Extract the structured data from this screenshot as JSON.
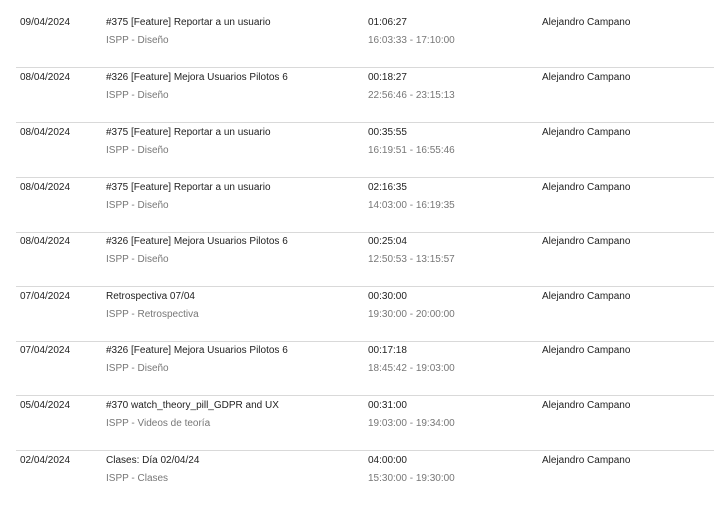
{
  "entries": [
    {
      "date": "09/04/2024",
      "task": "#375 [Feature] Reportar a un usuario",
      "project": "ISPP - Diseño",
      "duration": "01:06:27",
      "range": "16:03:33 - 17:10:00",
      "user": "Alejandro Campano"
    },
    {
      "date": "08/04/2024",
      "task": "#326 [Feature] Mejora Usuarios Pilotos 6",
      "project": "ISPP - Diseño",
      "duration": "00:18:27",
      "range": "22:56:46 - 23:15:13",
      "user": "Alejandro Campano"
    },
    {
      "date": "08/04/2024",
      "task": "#375 [Feature] Reportar a un usuario",
      "project": "ISPP - Diseño",
      "duration": "00:35:55",
      "range": "16:19:51 - 16:55:46",
      "user": "Alejandro Campano"
    },
    {
      "date": "08/04/2024",
      "task": "#375 [Feature] Reportar a un usuario",
      "project": "ISPP - Diseño",
      "duration": "02:16:35",
      "range": "14:03:00 - 16:19:35",
      "user": "Alejandro Campano"
    },
    {
      "date": "08/04/2024",
      "task": "#326 [Feature] Mejora Usuarios Pilotos 6",
      "project": "ISPP - Diseño",
      "duration": "00:25:04",
      "range": "12:50:53 - 13:15:57",
      "user": "Alejandro Campano"
    },
    {
      "date": "07/04/2024",
      "task": "Retrospectiva 07/04",
      "project": "ISPP - Retrospectiva",
      "duration": "00:30:00",
      "range": "19:30:00 - 20:00:00",
      "user": "Alejandro Campano"
    },
    {
      "date": "07/04/2024",
      "task": "#326 [Feature] Mejora Usuarios Pilotos 6",
      "project": "ISPP - Diseño",
      "duration": "00:17:18",
      "range": "18:45:42 - 19:03:00",
      "user": "Alejandro Campano"
    },
    {
      "date": "05/04/2024",
      "task": "#370 watch_theory_pill_GDPR and UX",
      "project": "ISPP - Videos de teoría",
      "duration": "00:31:00",
      "range": "19:03:00 - 19:34:00",
      "user": "Alejandro Campano"
    },
    {
      "date": "02/04/2024",
      "task": "Clases: Día 02/04/24",
      "project": "ISPP - Clases",
      "duration": "04:00:00",
      "range": "15:30:00 - 19:30:00",
      "user": "Alejandro Campano"
    }
  ]
}
